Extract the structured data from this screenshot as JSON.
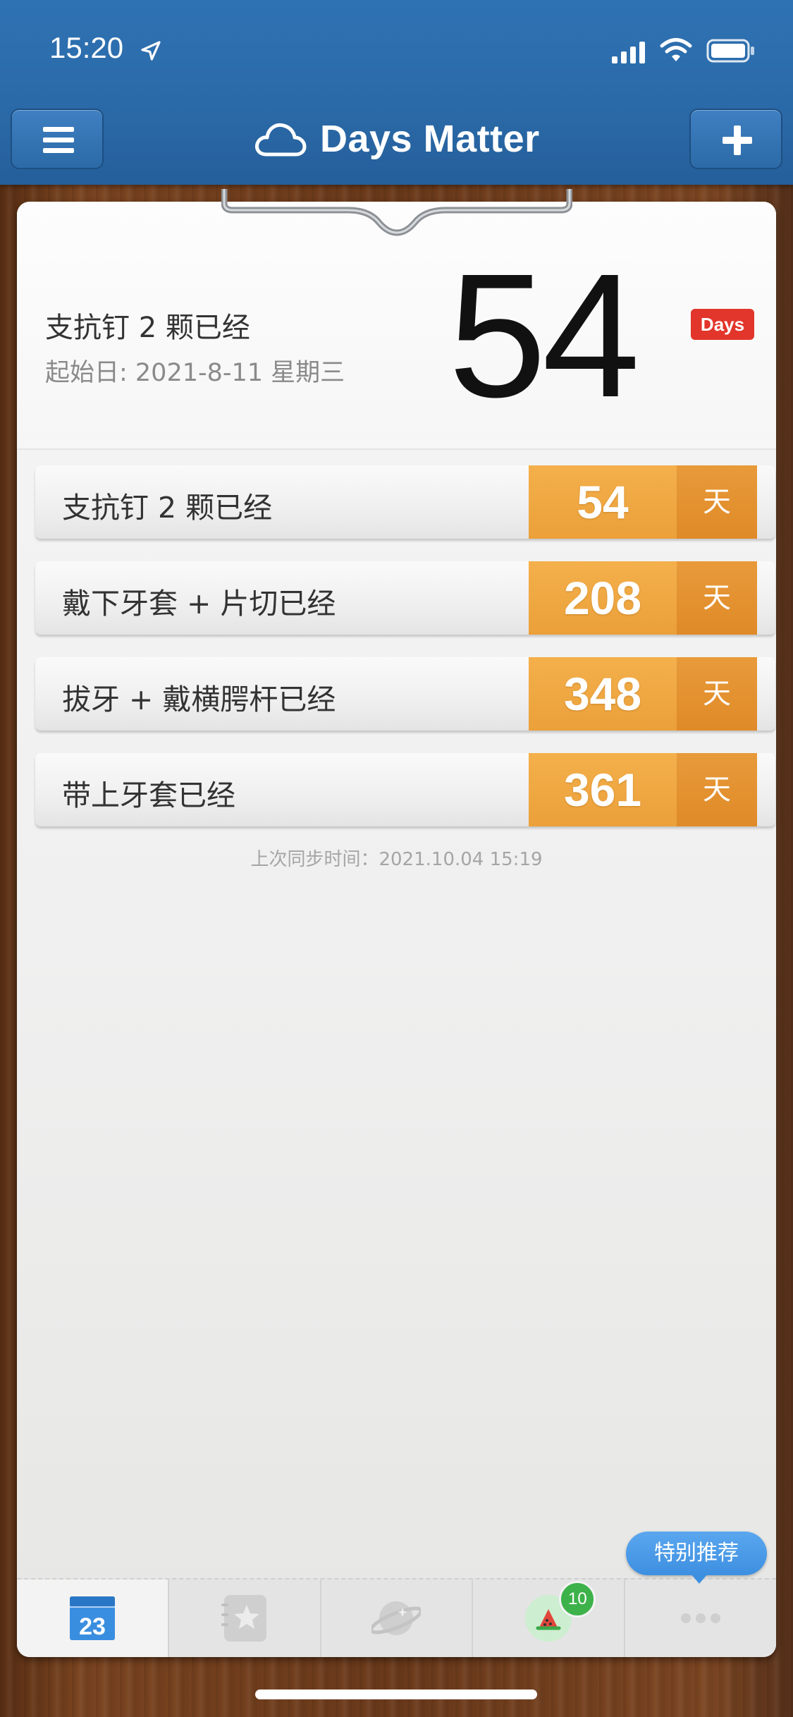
{
  "status_bar": {
    "time": "15:20"
  },
  "nav": {
    "title": "Days Matter"
  },
  "header": {
    "title": "支抗钉 2 颗已经",
    "start_date": "起始日: 2021-8-11 星期三",
    "count": "54",
    "badge": "Days"
  },
  "events": [
    {
      "label": "支抗钉 2 颗已经",
      "count": "54",
      "unit": "天"
    },
    {
      "label": "戴下牙套 + 片切已经",
      "count": "208",
      "unit": "天"
    },
    {
      "label": "拔牙 + 戴横腭杆已经",
      "count": "348",
      "unit": "天"
    },
    {
      "label": "带上牙套已经",
      "count": "361",
      "unit": "天"
    }
  ],
  "sync_text": "上次同步时间：2021.10.04 15:19",
  "recommend_label": "特别推荐",
  "tabs": [
    {
      "icon": "calendar-icon",
      "text": "23",
      "active": true
    },
    {
      "icon": "star-notebook-icon"
    },
    {
      "icon": "planet-icon"
    },
    {
      "icon": "watermelon-icon",
      "badge": "10"
    },
    {
      "icon": "more-icon"
    }
  ],
  "colors": {
    "nav_blue": "#2f72b3",
    "count_orange": "#f4b04b",
    "unit_orange": "#e08a28",
    "badge_red": "#e2352b",
    "badge_green": "#3db24a"
  }
}
